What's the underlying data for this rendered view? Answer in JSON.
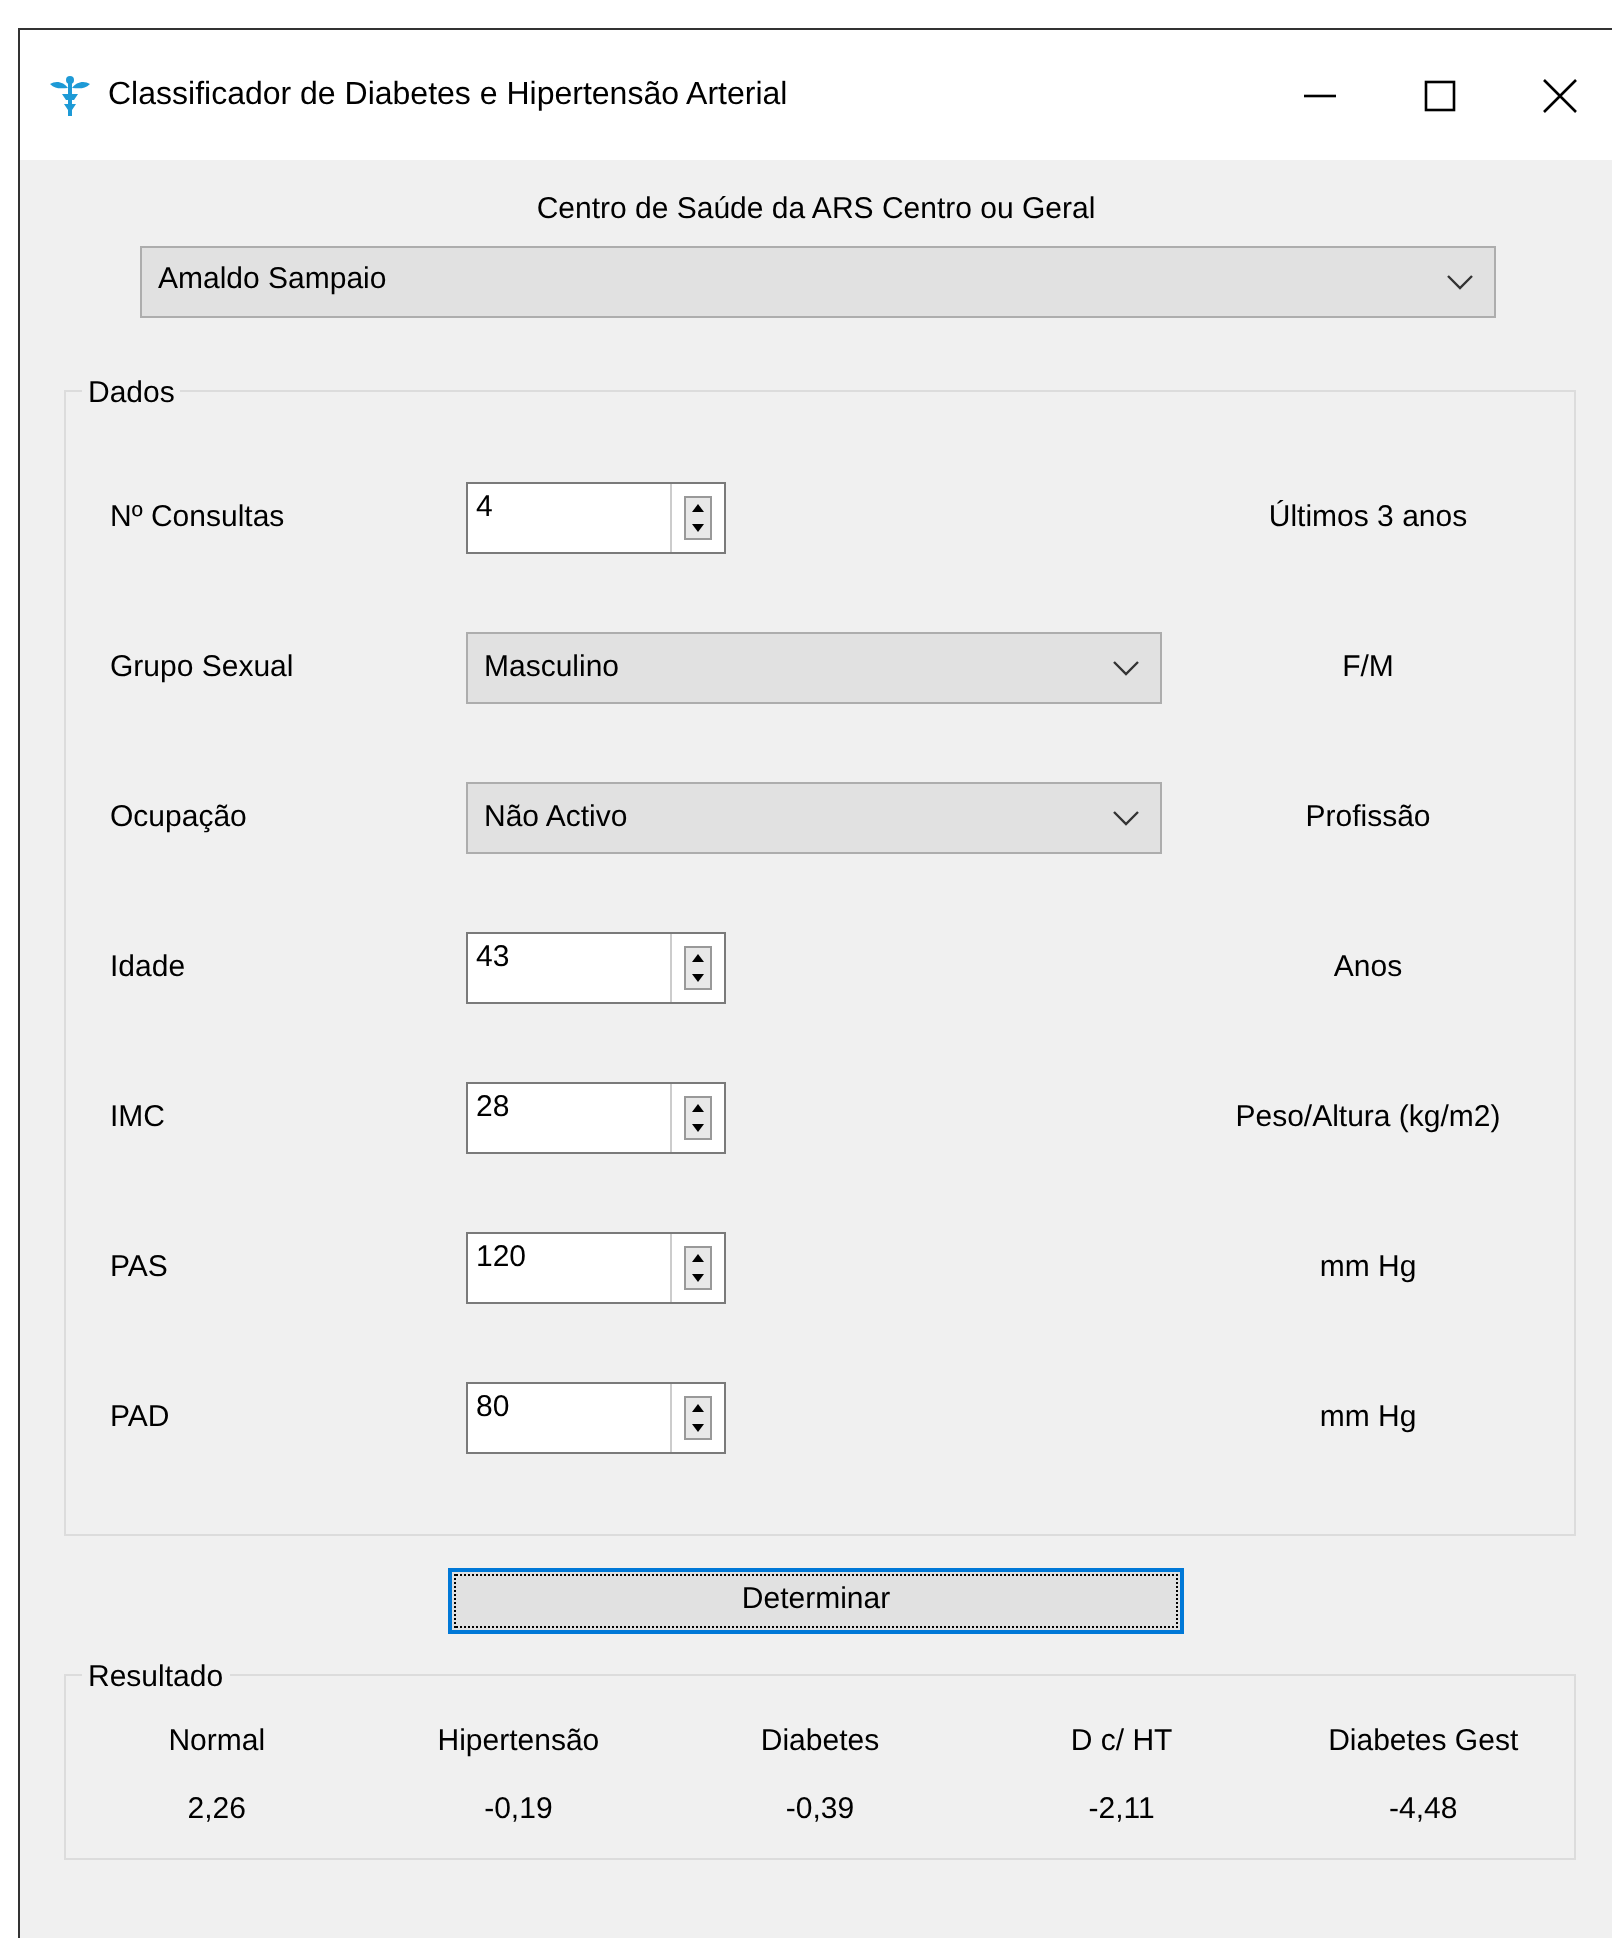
{
  "window": {
    "title": "Classificador de Diabetes e Hipertensão Arterial"
  },
  "centre": {
    "label": "Centro de Saúde da ARS Centro ou Geral",
    "value": "Amaldo Sampaio"
  },
  "dados": {
    "title": "Dados",
    "fields": [
      {
        "label": "Nº Consultas",
        "kind": "spin",
        "value": "4",
        "unit": "Últimos 3 anos"
      },
      {
        "label": "Grupo Sexual",
        "kind": "combo",
        "value": "Masculino",
        "unit": "F/M"
      },
      {
        "label": "Ocupação",
        "kind": "combo",
        "value": "Não Activo",
        "unit": "Profissão"
      },
      {
        "label": "Idade",
        "kind": "spin",
        "value": "43",
        "unit": "Anos"
      },
      {
        "label": "IMC",
        "kind": "spin",
        "value": "28",
        "unit": "Peso/Altura (kg/m2)"
      },
      {
        "label": "PAS",
        "kind": "spin",
        "value": "120",
        "unit": "mm Hg"
      },
      {
        "label": "PAD",
        "kind": "spin",
        "value": "80",
        "unit": "mm Hg"
      }
    ]
  },
  "button": {
    "label": "Determinar",
    "focused": true
  },
  "resultado": {
    "title": "Resultado",
    "columns": [
      {
        "label": "Normal",
        "value": "2,26"
      },
      {
        "label": "Hipertensão",
        "value": "-0,19"
      },
      {
        "label": "Diabetes",
        "value": "-0,39"
      },
      {
        "label": "D c/ HT",
        "value": "-2,11"
      },
      {
        "label": "Diabetes Gest",
        "value": "-4,48"
      }
    ]
  }
}
